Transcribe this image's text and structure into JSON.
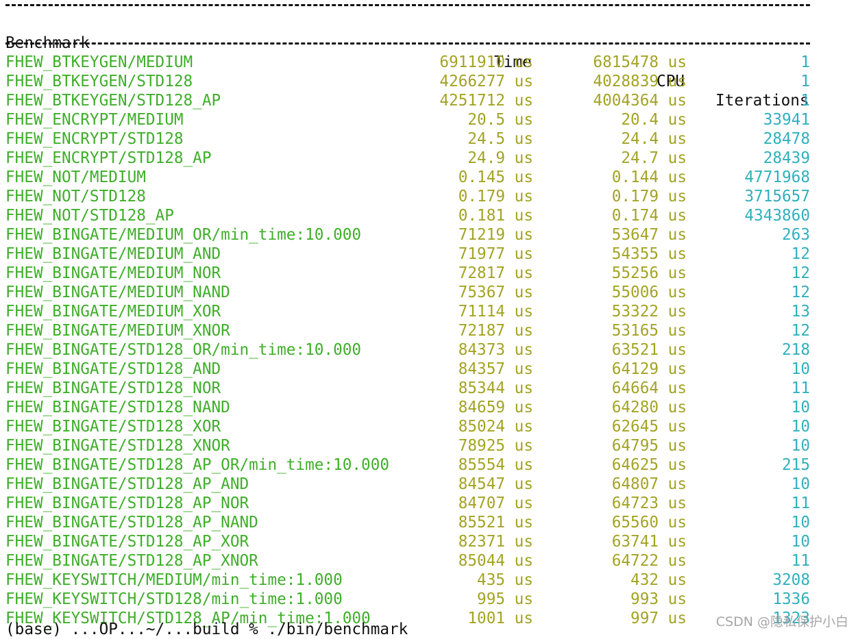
{
  "header": {
    "benchmark_label": "Benchmark",
    "time_label": "Time",
    "cpu_label": "CPU",
    "iterations_label": "Iterations"
  },
  "rows": [
    {
      "name": "FHEW_BTKEYGEN/MEDIUM",
      "time": "6911910 us",
      "cpu": "6815478 us",
      "iterations": "1"
    },
    {
      "name": "FHEW_BTKEYGEN/STD128",
      "time": "4266277 us",
      "cpu": "4028839 us",
      "iterations": "1"
    },
    {
      "name": "FHEW_BTKEYGEN/STD128_AP",
      "time": "4251712 us",
      "cpu": "4004364 us",
      "iterations": "1"
    },
    {
      "name": "FHEW_ENCRYPT/MEDIUM",
      "time": "20.5 us",
      "cpu": "20.4 us",
      "iterations": "33941"
    },
    {
      "name": "FHEW_ENCRYPT/STD128",
      "time": "24.5 us",
      "cpu": "24.4 us",
      "iterations": "28478"
    },
    {
      "name": "FHEW_ENCRYPT/STD128_AP",
      "time": "24.9 us",
      "cpu": "24.7 us",
      "iterations": "28439"
    },
    {
      "name": "FHEW_NOT/MEDIUM",
      "time": "0.145 us",
      "cpu": "0.144 us",
      "iterations": "4771968"
    },
    {
      "name": "FHEW_NOT/STD128",
      "time": "0.179 us",
      "cpu": "0.179 us",
      "iterations": "3715657"
    },
    {
      "name": "FHEW_NOT/STD128_AP",
      "time": "0.181 us",
      "cpu": "0.174 us",
      "iterations": "4343860"
    },
    {
      "name": "FHEW_BINGATE/MEDIUM_OR/min_time:10.000",
      "time": "71219 us",
      "cpu": "53647 us",
      "iterations": "263"
    },
    {
      "name": "FHEW_BINGATE/MEDIUM_AND",
      "time": "71977 us",
      "cpu": "54355 us",
      "iterations": "12"
    },
    {
      "name": "FHEW_BINGATE/MEDIUM_NOR",
      "time": "72817 us",
      "cpu": "55256 us",
      "iterations": "12"
    },
    {
      "name": "FHEW_BINGATE/MEDIUM_NAND",
      "time": "75367 us",
      "cpu": "55006 us",
      "iterations": "12"
    },
    {
      "name": "FHEW_BINGATE/MEDIUM_XOR",
      "time": "71114 us",
      "cpu": "53322 us",
      "iterations": "13"
    },
    {
      "name": "FHEW_BINGATE/MEDIUM_XNOR",
      "time": "72187 us",
      "cpu": "53165 us",
      "iterations": "12"
    },
    {
      "name": "FHEW_BINGATE/STD128_OR/min_time:10.000",
      "time": "84373 us",
      "cpu": "63521 us",
      "iterations": "218"
    },
    {
      "name": "FHEW_BINGATE/STD128_AND",
      "time": "84357 us",
      "cpu": "64129 us",
      "iterations": "10"
    },
    {
      "name": "FHEW_BINGATE/STD128_NOR",
      "time": "85344 us",
      "cpu": "64664 us",
      "iterations": "11"
    },
    {
      "name": "FHEW_BINGATE/STD128_NAND",
      "time": "84659 us",
      "cpu": "64280 us",
      "iterations": "10"
    },
    {
      "name": "FHEW_BINGATE/STD128_XOR",
      "time": "85024 us",
      "cpu": "62645 us",
      "iterations": "10"
    },
    {
      "name": "FHEW_BINGATE/STD128_XNOR",
      "time": "78925 us",
      "cpu": "64795 us",
      "iterations": "10"
    },
    {
      "name": "FHEW_BINGATE/STD128_AP_OR/min_time:10.000",
      "time": "85554 us",
      "cpu": "64625 us",
      "iterations": "215"
    },
    {
      "name": "FHEW_BINGATE/STD128_AP_AND",
      "time": "84547 us",
      "cpu": "64807 us",
      "iterations": "10"
    },
    {
      "name": "FHEW_BINGATE/STD128_AP_NOR",
      "time": "84707 us",
      "cpu": "64723 us",
      "iterations": "11"
    },
    {
      "name": "FHEW_BINGATE/STD128_AP_NAND",
      "time": "85521 us",
      "cpu": "65560 us",
      "iterations": "10"
    },
    {
      "name": "FHEW_BINGATE/STD128_AP_XOR",
      "time": "82371 us",
      "cpu": "63741 us",
      "iterations": "10"
    },
    {
      "name": "FHEW_BINGATE/STD128_AP_XNOR",
      "time": "85044 us",
      "cpu": "64722 us",
      "iterations": "11"
    },
    {
      "name": "FHEW_KEYSWITCH/MEDIUM/min_time:1.000",
      "time": "435 us",
      "cpu": "432 us",
      "iterations": "3208"
    },
    {
      "name": "FHEW_KEYSWITCH/STD128/min_time:1.000",
      "time": "995 us",
      "cpu": "993 us",
      "iterations": "1336"
    },
    {
      "name": "FHEW_KEYSWITCH/STD128_AP/min_time:1.000",
      "time": "1001 us",
      "cpu": "997 us",
      "iterations": "1323"
    }
  ],
  "prompt_partial": "(base) ...OP...~/...build % ./bin/benchmark",
  "watermark": "CSDN @隐私保护小白",
  "colors": {
    "name": "#3fae2a",
    "value": "#a3a324",
    "iterations": "#2fb0be",
    "text": "#111111",
    "background": "#ffffff"
  }
}
